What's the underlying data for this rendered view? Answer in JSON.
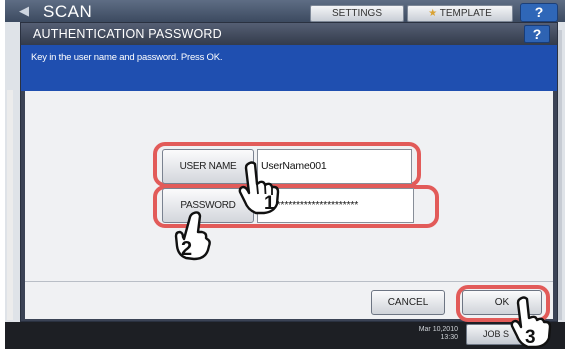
{
  "background": {
    "screen_title": "SCAN",
    "settings_label": "SETTINGS",
    "template_label": "TEMPLATE",
    "help_label": "?",
    "date_text": "Mar 10,2010 13:30",
    "job_status_label": "JOB S"
  },
  "dialog": {
    "title": "AUTHENTICATION PASSWORD",
    "help_label": "?",
    "instruction": "Key in the user name and password. Press OK.",
    "user_name_label": "USER NAME",
    "user_name_value": "UserName001",
    "password_label": "PASSWORD",
    "password_value": "*************************",
    "cancel_label": "CANCEL",
    "ok_label": "OK"
  },
  "callouts": {
    "step1": "1",
    "step2": "2",
    "step3": "3"
  },
  "colors": {
    "highlight": "#e25b59",
    "instruction_bar": "#1f4fb0",
    "titlebar": "#3b4355"
  }
}
